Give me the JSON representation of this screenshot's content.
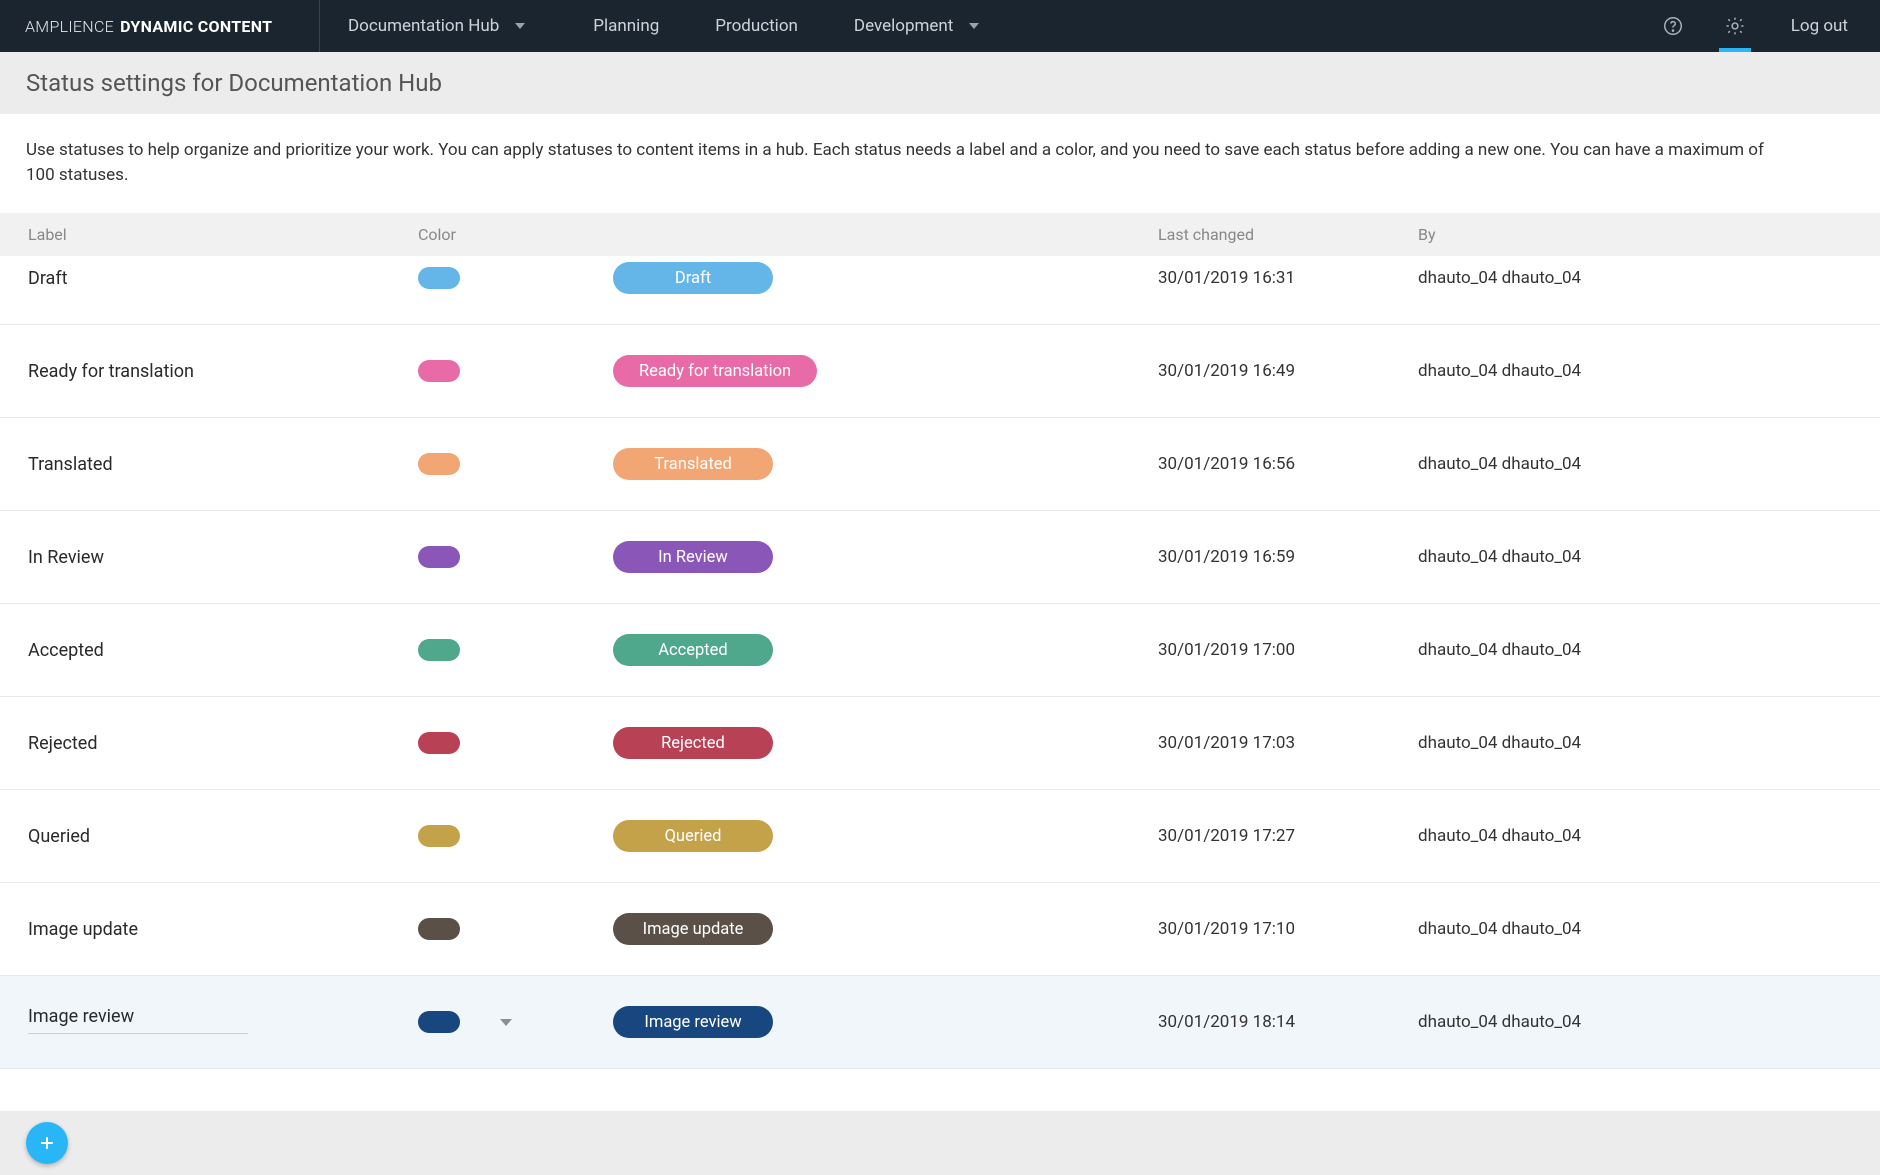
{
  "brand": {
    "light": "AMPLIENCE",
    "bold": "DYNAMIC CONTENT"
  },
  "nav": {
    "hub": "Documentation Hub",
    "items": [
      "Planning",
      "Production",
      "Development"
    ],
    "logout": "Log out"
  },
  "page": {
    "title": "Status settings for Documentation Hub",
    "intro": "Use statuses to help organize and prioritize your work. You can apply statuses to content items in a hub. Each status needs a label and a color, and you need to save each status before adding a new one. You can have a maximum of 100 statuses."
  },
  "columns": {
    "label": "Label",
    "color": "Color",
    "last": "Last changed",
    "by": "By"
  },
  "statuses": [
    {
      "label": "Draft",
      "color": "#64b5e8",
      "chip_label": "Draft",
      "last": "30/01/2019 16:31",
      "by": "dhauto_04 dhauto_04"
    },
    {
      "label": "Ready for translation",
      "color": "#e86aa6",
      "chip_label": "Ready for translation",
      "last": "30/01/2019 16:49",
      "by": "dhauto_04 dhauto_04"
    },
    {
      "label": "Translated",
      "color": "#f2a673",
      "chip_label": "Translated",
      "last": "30/01/2019 16:56",
      "by": "dhauto_04 dhauto_04"
    },
    {
      "label": "In Review",
      "color": "#8a57b8",
      "chip_label": "In Review",
      "last": "30/01/2019 16:59",
      "by": "dhauto_04 dhauto_04"
    },
    {
      "label": "Accepted",
      "color": "#4fa88b",
      "chip_label": "Accepted",
      "last": "30/01/2019 17:00",
      "by": "dhauto_04 dhauto_04"
    },
    {
      "label": "Rejected",
      "color": "#b94156",
      "chip_label": "Rejected",
      "last": "30/01/2019 17:03",
      "by": "dhauto_04 dhauto_04"
    },
    {
      "label": "Queried",
      "color": "#c4a24a",
      "chip_label": "Queried",
      "last": "30/01/2019 17:27",
      "by": "dhauto_04 dhauto_04"
    },
    {
      "label": "Image update",
      "color": "#5b5048",
      "chip_label": "Image update",
      "last": "30/01/2019 17:10",
      "by": "dhauto_04 dhauto_04"
    },
    {
      "label": "Image review",
      "color": "#17477e",
      "chip_label": "Image review",
      "last": "30/01/2019 18:14",
      "by": "dhauto_04 dhauto_04",
      "selected": true
    }
  ]
}
